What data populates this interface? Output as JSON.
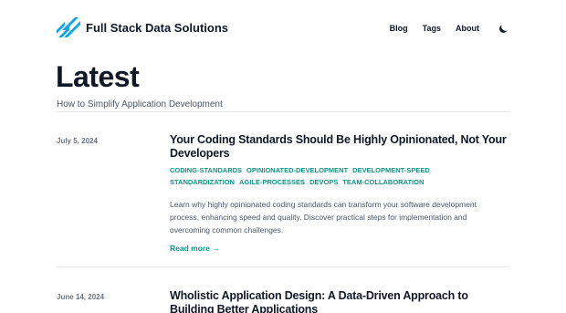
{
  "header": {
    "site_title": "Full Stack Data Solutions",
    "nav": [
      {
        "label": "Blog"
      },
      {
        "label": "Tags"
      },
      {
        "label": "About"
      }
    ],
    "logo_icon": "slanted-stripes-logo",
    "theme_toggle_icon": "moon-icon"
  },
  "main": {
    "heading": "Latest",
    "subtitle": "How to Simplify Application Development",
    "posts": [
      {
        "date": "July 5, 2024",
        "title": "Your Coding Standards Should Be Highly Opinionated, Not Your Developers",
        "tags": [
          "CODING-STANDARDS",
          "OPINIONATED-DEVELOPMENT",
          "DEVELOPMENT-SPEED",
          "STANDARDIZATION",
          "AGILE-PROCESSES",
          "DEVOPS",
          "TEAM-COLLABORATION"
        ],
        "excerpt": "Learn why highly opinionated coding standards can transform your software development process, enhancing speed and quality. Discover practical steps for implementation and overcoming common challenges.",
        "read_more": "Read more →"
      },
      {
        "date": "June 14, 2024",
        "title": "Wholistic Application Design: A Data-Driven Approach to Building Better Applications"
      }
    ]
  },
  "colors": {
    "accent": "#0d9488",
    "logo": "#0ea5e9",
    "text": "#111827",
    "muted": "#4b5563"
  }
}
